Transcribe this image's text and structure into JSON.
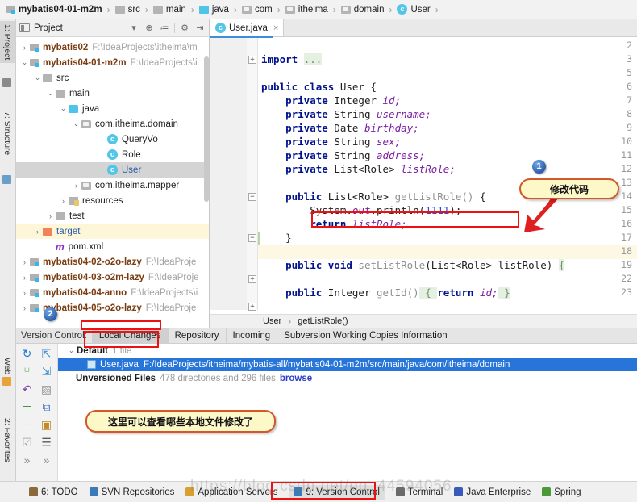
{
  "breadcrumb": [
    {
      "label": "mybatis04-01-m2m",
      "icon": "module-icon",
      "kind": "module"
    },
    {
      "label": "src",
      "icon": "folder-icon",
      "kind": "folder"
    },
    {
      "label": "main",
      "icon": "folder-icon",
      "kind": "folder"
    },
    {
      "label": "java",
      "icon": "source-folder-icon",
      "kind": "source"
    },
    {
      "label": "com",
      "icon": "package-icon",
      "kind": "package"
    },
    {
      "label": "itheima",
      "icon": "package-icon",
      "kind": "package"
    },
    {
      "label": "domain",
      "icon": "package-icon",
      "kind": "package"
    },
    {
      "label": "User",
      "icon": "class-icon",
      "kind": "class"
    }
  ],
  "left_tool_tabs": [
    {
      "label": "1: Project",
      "selected": true,
      "icon": "project-icon"
    },
    {
      "label": "7: Structure",
      "selected": false,
      "icon": "structure-icon"
    },
    {
      "label": "Web",
      "selected": false,
      "icon": "web-icon"
    },
    {
      "label": "2: Favorites",
      "selected": false,
      "icon": "star-icon"
    }
  ],
  "project_panel": {
    "title": "Project",
    "toolbar": [
      {
        "name": "view-options-dropdown",
        "glyph": "▾"
      },
      {
        "name": "locate-icon",
        "glyph": "⊕"
      },
      {
        "name": "collapse-all-icon",
        "glyph": "≔"
      },
      {
        "name": "settings-gear-icon",
        "glyph": "⚙"
      },
      {
        "name": "hide-panel-icon",
        "glyph": "⇥"
      }
    ],
    "tree": [
      {
        "label": "mybatis02",
        "path": "F:\\IdeaProjects\\itheima\\m",
        "indent": 0,
        "arrow": "›",
        "icon": "module-icon",
        "style": "module"
      },
      {
        "label": "mybatis04-01-m2m",
        "path": "F:\\IdeaProjects\\i",
        "indent": 0,
        "arrow": "⌄",
        "icon": "module-icon",
        "style": "module"
      },
      {
        "label": "src",
        "path": "",
        "indent": 1,
        "arrow": "⌄",
        "icon": "folder-icon",
        "style": "plain"
      },
      {
        "label": "main",
        "path": "",
        "indent": 2,
        "arrow": "⌄",
        "icon": "folder-icon",
        "style": "plain"
      },
      {
        "label": "java",
        "path": "",
        "indent": 3,
        "arrow": "⌄",
        "icon": "source-folder-icon",
        "style": "plain"
      },
      {
        "label": "com.itheima.domain",
        "path": "",
        "indent": 4,
        "arrow": "⌄",
        "icon": "package-icon",
        "style": "plain"
      },
      {
        "label": "QueryVo",
        "path": "",
        "indent": 6,
        "arrow": "",
        "icon": "class-icon",
        "style": "plain"
      },
      {
        "label": "Role",
        "path": "",
        "indent": 6,
        "arrow": "",
        "icon": "class-icon",
        "style": "plain"
      },
      {
        "label": "User",
        "path": "",
        "indent": 6,
        "arrow": "",
        "icon": "class-icon",
        "style": "selected-blue"
      },
      {
        "label": "com.itheima.mapper",
        "path": "",
        "indent": 4,
        "arrow": "›",
        "icon": "package-icon",
        "style": "plain"
      },
      {
        "label": "resources",
        "path": "",
        "indent": 3,
        "arrow": "›",
        "icon": "resources-icon",
        "style": "plain"
      },
      {
        "label": "test",
        "path": "",
        "indent": 2,
        "arrow": "›",
        "icon": "folder-icon",
        "style": "plain"
      },
      {
        "label": "target",
        "path": "",
        "indent": 1,
        "arrow": "›",
        "icon": "target-folder-icon",
        "style": "highlight"
      },
      {
        "label": "pom.xml",
        "path": "",
        "indent": 2,
        "arrow": "",
        "icon": "maven-icon",
        "style": "plain"
      },
      {
        "label": "mybatis04-02-o2o-lazy",
        "path": "F:\\IdeaProje",
        "indent": 0,
        "arrow": "›",
        "icon": "module-icon",
        "style": "module"
      },
      {
        "label": "mybatis04-03-o2m-lazy",
        "path": "F:\\IdeaProje",
        "indent": 0,
        "arrow": "›",
        "icon": "module-icon",
        "style": "module"
      },
      {
        "label": "mybatis04-04-anno",
        "path": "F:\\IdeaProjects\\i",
        "indent": 0,
        "arrow": "›",
        "icon": "module-icon",
        "style": "module"
      },
      {
        "label": "mybatis04-05-o2o-lazy",
        "path": "F:\\IdeaProje",
        "indent": 0,
        "arrow": "›",
        "icon": "module-icon",
        "style": "module"
      }
    ]
  },
  "editor": {
    "tab": {
      "label": "User.java",
      "icon": "class-icon",
      "close": "×"
    },
    "lines": [
      {
        "num": "2",
        "segments": []
      },
      {
        "num": "3",
        "segments": [
          {
            "t": "import ",
            "c": "kw"
          },
          {
            "t": "...",
            "c": "folded"
          }
        ]
      },
      {
        "num": "5",
        "segments": []
      },
      {
        "num": "6",
        "segments": [
          {
            "t": "public class ",
            "c": "kw"
          },
          {
            "t": "User {",
            "c": "typ"
          }
        ]
      },
      {
        "num": "7",
        "segments": [
          {
            "t": "    private ",
            "c": "kw"
          },
          {
            "t": "Integer ",
            "c": "typ"
          },
          {
            "t": "id;",
            "c": "fld"
          }
        ]
      },
      {
        "num": "8",
        "segments": [
          {
            "t": "    private ",
            "c": "kw"
          },
          {
            "t": "String ",
            "c": "typ"
          },
          {
            "t": "username;",
            "c": "fld"
          }
        ]
      },
      {
        "num": "9",
        "segments": [
          {
            "t": "    private ",
            "c": "kw"
          },
          {
            "t": "Date ",
            "c": "typ"
          },
          {
            "t": "birthday;",
            "c": "fld"
          }
        ]
      },
      {
        "num": "10",
        "segments": [
          {
            "t": "    private ",
            "c": "kw"
          },
          {
            "t": "String ",
            "c": "typ"
          },
          {
            "t": "sex;",
            "c": "fld"
          }
        ]
      },
      {
        "num": "11",
        "segments": [
          {
            "t": "    private ",
            "c": "kw"
          },
          {
            "t": "String ",
            "c": "typ"
          },
          {
            "t": "address;",
            "c": "fld"
          }
        ]
      },
      {
        "num": "12",
        "segments": [
          {
            "t": "    private ",
            "c": "kw"
          },
          {
            "t": "List<Role> ",
            "c": "typ"
          },
          {
            "t": "listRole;",
            "c": "fld"
          }
        ]
      },
      {
        "num": "13",
        "segments": []
      },
      {
        "num": "14",
        "segments": [
          {
            "t": "    public ",
            "c": "kw"
          },
          {
            "t": "List<Role> ",
            "c": "typ"
          },
          {
            "t": "getListRole()",
            "c": "mth"
          },
          {
            "t": " {",
            "c": "typ"
          }
        ]
      },
      {
        "num": "15",
        "segments": [
          {
            "t": "        System.",
            "c": "typ"
          },
          {
            "t": "out",
            "c": "fld"
          },
          {
            "t": ".println(",
            "c": "typ"
          },
          {
            "t": "1111",
            "c": "num"
          },
          {
            "t": ");",
            "c": "typ"
          }
        ]
      },
      {
        "num": "16",
        "segments": [
          {
            "t": "        return ",
            "c": "kw"
          },
          {
            "t": "listRole;",
            "c": "fld"
          }
        ]
      },
      {
        "num": "17",
        "segments": [
          {
            "t": "    }",
            "c": "typ"
          }
        ]
      },
      {
        "num": "18",
        "segments": []
      },
      {
        "num": "19",
        "segments": [
          {
            "t": "    public void ",
            "c": "kw"
          },
          {
            "t": "setListRole",
            "c": "mth"
          },
          {
            "t": "(List<Role> listRole) ",
            "c": "typ"
          },
          {
            "t": "{",
            "c": "folded"
          }
        ]
      },
      {
        "num": "22",
        "segments": []
      },
      {
        "num": "23",
        "segments": [
          {
            "t": "    public ",
            "c": "kw"
          },
          {
            "t": "Integer ",
            "c": "typ"
          },
          {
            "t": "getId()",
            "c": "mth"
          },
          {
            "t": " { ",
            "c": "folded"
          },
          {
            "t": "return ",
            "c": "kw"
          },
          {
            "t": "id;",
            "c": "fld"
          },
          {
            "t": " }",
            "c": "folded"
          }
        ]
      }
    ],
    "status_breadcrumb": [
      {
        "label": "User"
      },
      {
        "label": "getListRole()"
      }
    ],
    "breadcrumb_separator": "›"
  },
  "version_control": {
    "label": "Version Control:",
    "tabs": [
      {
        "label": "Local Changes",
        "selected": true
      },
      {
        "label": "Repository",
        "selected": false
      },
      {
        "label": "Incoming",
        "selected": false
      },
      {
        "label": "Subversion Working Copies Information",
        "selected": false
      }
    ],
    "toolbar_icons": [
      {
        "name": "refresh-icon",
        "glyph": "↻",
        "color": "#2277cc"
      },
      {
        "name": "expand-all-icon",
        "glyph": "⇱",
        "color": "#3b8ed1"
      },
      {
        "name": "commit-icon",
        "glyph": "⑂",
        "color": "#4ca64c"
      },
      {
        "name": "collapse-all-icon",
        "glyph": "⇲",
        "color": "#3b8ed1"
      },
      {
        "name": "rollback-icon",
        "glyph": "↶",
        "color": "#7a3fa8"
      },
      {
        "name": "show-diff-icon",
        "glyph": "▧",
        "color": "#9a9a9a"
      },
      {
        "name": "new-changelist-icon",
        "glyph": "＋",
        "color": "#3a9b3a"
      },
      {
        "name": "copy-icon",
        "glyph": "⧉",
        "color": "#3b73c4"
      },
      {
        "name": "delete-changelist-icon",
        "glyph": "−",
        "color": "#a8a8a8"
      },
      {
        "name": "shelve-icon",
        "glyph": "▣",
        "color": "#c08a2a"
      },
      {
        "name": "select-checkbox-icon",
        "glyph": "☑",
        "color": "#9a9a9a"
      },
      {
        "name": "group-by-icon",
        "glyph": "☰",
        "color": "#5a5a5a"
      },
      {
        "name": "more-left-icon",
        "glyph": "»",
        "color": "#8a8a8a"
      },
      {
        "name": "more-right-icon",
        "glyph": "»",
        "color": "#8a8a8a"
      }
    ],
    "changelist": {
      "arrow": "⌄",
      "name": "Default",
      "count": "1 file"
    },
    "changed_file": {
      "name": "User.java",
      "path": "F:/IdeaProjects/itheima/mybatis-all/mybatis04-01-m2m/src/main/java/com/itheima/domain",
      "icon": "java-file-icon"
    },
    "unversioned": {
      "label": "Unversioned Files",
      "count": "478 directories and 296 files",
      "link": "browse"
    }
  },
  "status_bar": [
    {
      "label": "6: TODO",
      "underline": "6",
      "icon": "todo-icon",
      "selected": false
    },
    {
      "label": "SVN Repositories",
      "underline": "",
      "icon": "svn-icon",
      "selected": false
    },
    {
      "label": "Application Servers",
      "underline": "",
      "icon": "app-servers-icon",
      "selected": false
    },
    {
      "label": "9: Version Control",
      "underline": "9",
      "icon": "version-control-icon",
      "selected": true
    },
    {
      "label": "Terminal",
      "underline": "",
      "icon": "terminal-icon",
      "selected": false
    },
    {
      "label": "Java Enterprise",
      "underline": "",
      "icon": "java-enterprise-icon",
      "selected": false
    },
    {
      "label": "Spring",
      "underline": "",
      "icon": "spring-icon",
      "selected": false
    }
  ],
  "annotations": {
    "badge1": "1",
    "badge2": "2",
    "callout_code": "修改代码",
    "callout_vcs": "这里可以查看哪些本地文件修改了"
  },
  "watermark": "https://blog.csdn.net/qq_44594056",
  "colors": {
    "accent": "#2775d9",
    "annotation_red": "#ee1111",
    "callout_fill": "#fdf8c8",
    "callout_border": "#d4572a"
  }
}
